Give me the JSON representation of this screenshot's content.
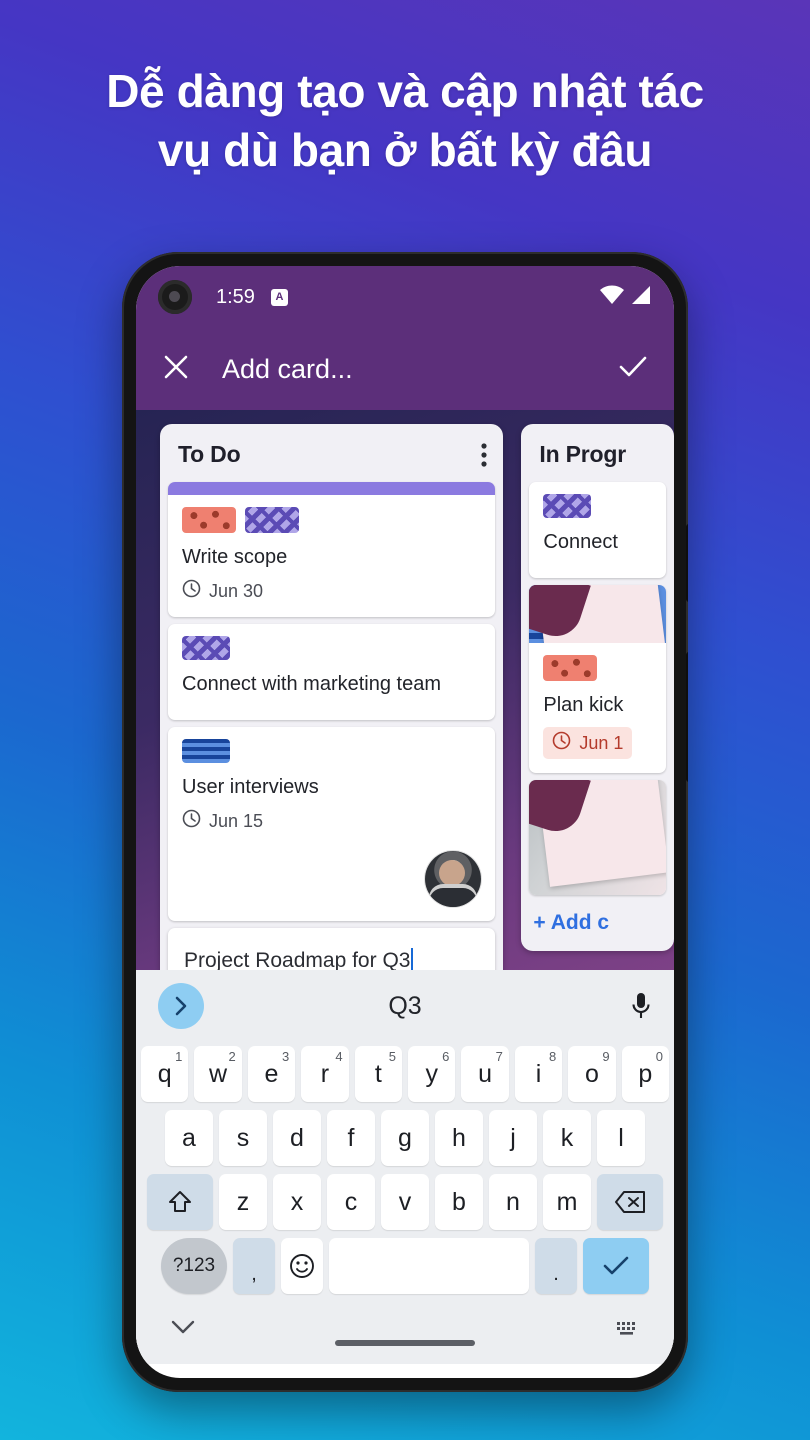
{
  "headline": {
    "line1": "Dễ dàng tạo và cập nhật tác",
    "line2": "vụ dù bạn ở bất kỳ đâu"
  },
  "status_bar": {
    "time": "1:59",
    "badge": "A",
    "wifi_icon": "wifi-icon",
    "signal_icon": "cellular-signal-icon"
  },
  "app_bar": {
    "close_icon": "close-icon",
    "title": "Add card...",
    "confirm_icon": "check-icon"
  },
  "board": {
    "lists": [
      {
        "title": "To Do",
        "menu_icon": "more-vertical-icon",
        "cards": [
          {
            "title": "Write scope",
            "due": "Jun 30",
            "due_icon": "clock-icon"
          },
          {
            "title": "Connect with marketing team"
          },
          {
            "title": "User interviews",
            "due": "Jun 15",
            "due_icon": "clock-icon"
          }
        ]
      },
      {
        "title": "In Progr",
        "cards": [
          {
            "title": "Connect"
          },
          {
            "title": "Plan kick",
            "due": "Jun 1",
            "due_icon": "clock-icon"
          }
        ],
        "add_card_label": "+ Add c"
      }
    ]
  },
  "compose": {
    "text": "Project Roadmap for ",
    "composing": "Q3"
  },
  "keyboard": {
    "suggestion": "Q3",
    "next_icon": "chevron-right-icon",
    "mic_icon": "microphone-icon",
    "row1": [
      {
        "letter": "q",
        "num": "1"
      },
      {
        "letter": "w",
        "num": "2"
      },
      {
        "letter": "e",
        "num": "3"
      },
      {
        "letter": "r",
        "num": "4"
      },
      {
        "letter": "t",
        "num": "5"
      },
      {
        "letter": "y",
        "num": "6"
      },
      {
        "letter": "u",
        "num": "7"
      },
      {
        "letter": "i",
        "num": "8"
      },
      {
        "letter": "o",
        "num": "9"
      },
      {
        "letter": "p",
        "num": "0"
      }
    ],
    "row2": [
      "a",
      "s",
      "d",
      "f",
      "g",
      "h",
      "j",
      "k",
      "l"
    ],
    "row3": [
      "z",
      "x",
      "c",
      "v",
      "b",
      "n",
      "m"
    ],
    "shift_icon": "shift-icon",
    "backspace_icon": "backspace-icon",
    "symbols_label": "?123",
    "comma": ",",
    "emoji_icon": "emoji-icon",
    "period": ".",
    "enter_icon": "check-icon"
  },
  "nav_bar": {
    "hide_keyboard_icon": "chevron-down-icon",
    "keyboard_switch_icon": "keyboard-switch-icon"
  },
  "colors": {
    "app_bar": "#5c2f7a",
    "accent_blue": "#1769d6",
    "key_accent": "#8ecdf2",
    "overdue": "#b43b2c"
  }
}
